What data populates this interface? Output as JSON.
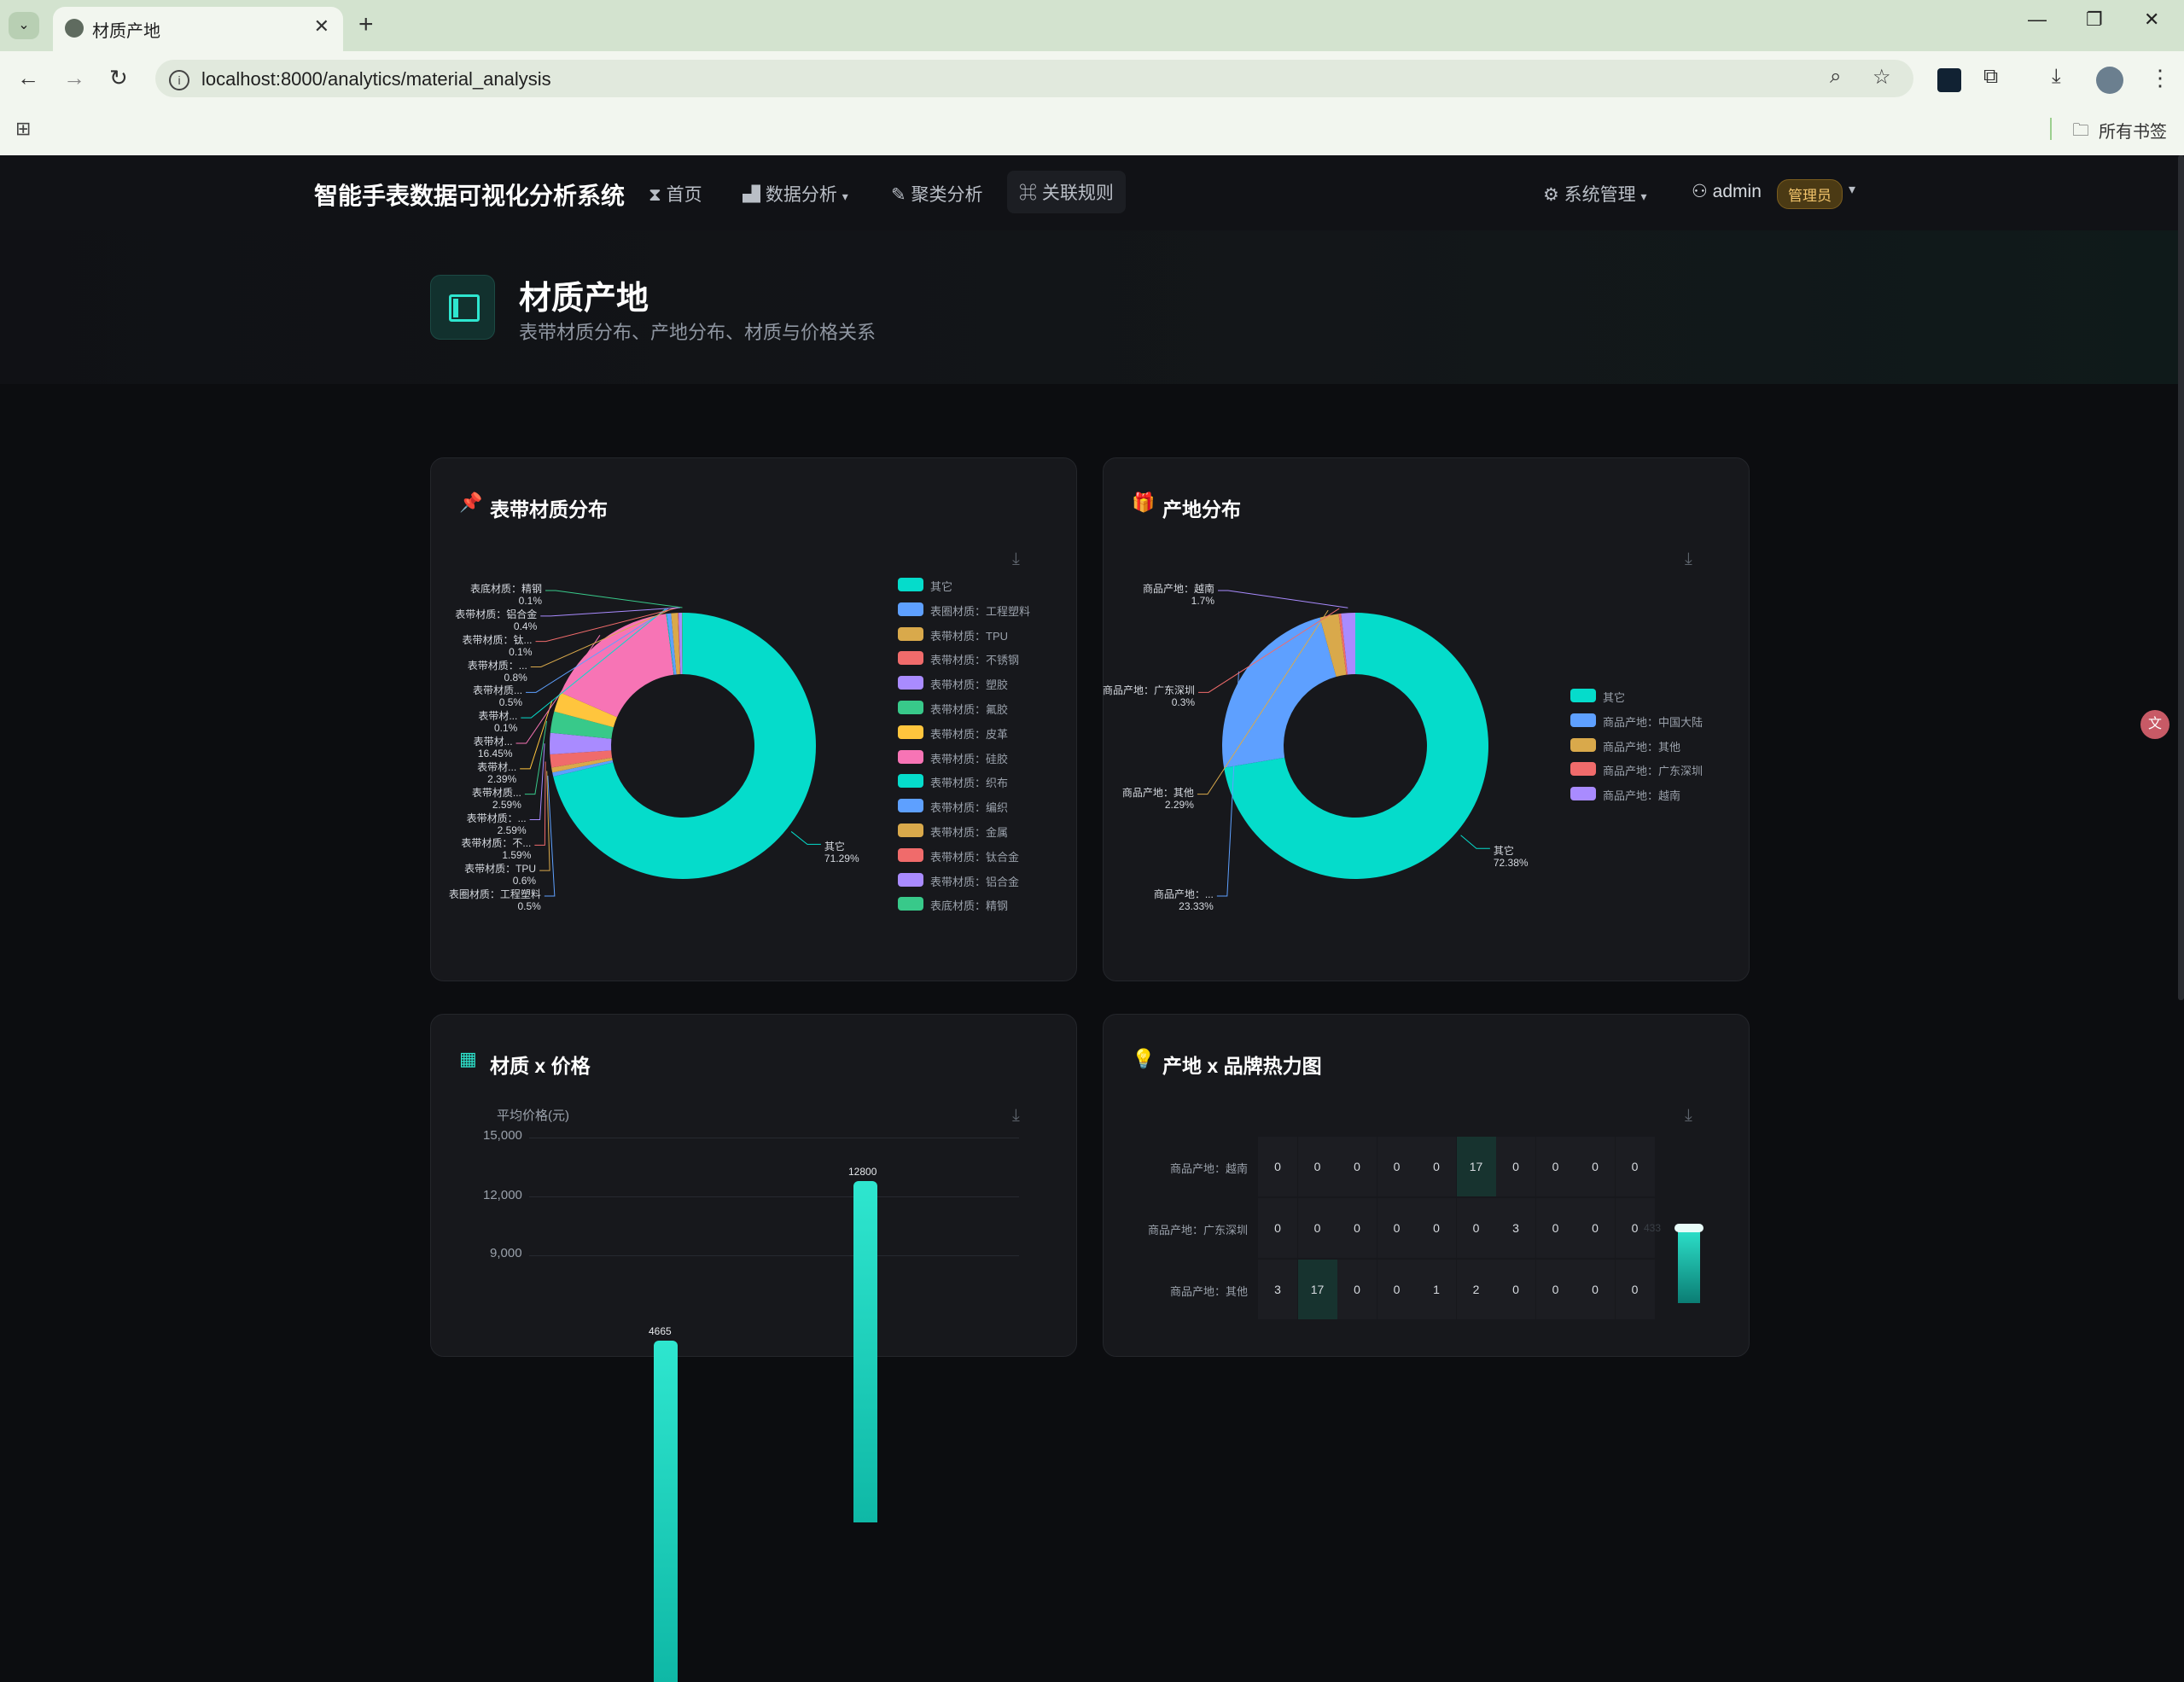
{
  "browser": {
    "tab_title": "材质产地",
    "url": "localhost:8000/analytics/material_analysis",
    "bookmarks_label": "所有书签"
  },
  "app": {
    "brand": "智能手表数据可视化分析系统",
    "nav": [
      {
        "label": "首页",
        "icon": "hourglass-icon"
      },
      {
        "label": "数据分析",
        "icon": "bar-chart-icon",
        "dropdown": true
      },
      {
        "label": "聚类分析",
        "icon": "thumbs-down-icon"
      },
      {
        "label": "关联规则",
        "icon": "gamepad-icon",
        "active": true
      }
    ],
    "system_menu": "系统管理",
    "user": "admin",
    "role_badge": "管理员"
  },
  "page": {
    "title": "材质产地",
    "subtitle": "表带材质分布、产地分布、材质与价格关系"
  },
  "cards": {
    "material": {
      "title": "表带材质分布"
    },
    "origin": {
      "title": "产地分布"
    },
    "price": {
      "title": "材质 x 价格"
    },
    "heatmap": {
      "title": "产地 x 品牌热力图"
    }
  },
  "colors": {
    "accent": "#2ee6cf",
    "palette": [
      "#05dccb",
      "#5ea0ff",
      "#d9a94b",
      "#f06b6b",
      "#a98bff",
      "#38c98a",
      "#ffc53d",
      "#f774b5",
      "#05dccb",
      "#5ea0ff",
      "#d9a94b",
      "#f06b6b",
      "#a98bff",
      "#38c98a"
    ]
  },
  "chart_data": [
    {
      "type": "pie",
      "title": "表带材质分布",
      "legend_position": "right",
      "slices": [
        {
          "label": "其它",
          "value": 71.29
        },
        {
          "label": "表圈材质：工程塑料",
          "value": 0.5
        },
        {
          "label": "表带材质：TPU",
          "value": 0.6
        },
        {
          "label": "表带材质：不锈钢",
          "value": 1.59
        },
        {
          "label": "表带材质：塑胶",
          "value": 2.59
        },
        {
          "label": "表带材质：氟胶",
          "value": 2.59
        },
        {
          "label": "表带材质：皮革",
          "value": 2.39
        },
        {
          "label": "表带材质：硅胶",
          "value": 16.45
        },
        {
          "label": "表带材质：织布",
          "value": 0.1
        },
        {
          "label": "表带材质：编织",
          "value": 0.5
        },
        {
          "label": "表带材质：金属",
          "value": 0.8
        },
        {
          "label": "表带材质：钛合金",
          "value": 0.1
        },
        {
          "label": "表带材质：铝合金",
          "value": 0.4
        },
        {
          "label": "表底材质：精钢",
          "value": 0.1
        }
      ],
      "slice_labels": [
        {
          "name": "其它",
          "pct": "71.29%"
        },
        {
          "name": "表圈材质：工程塑料",
          "pct": "0.5%"
        },
        {
          "name": "表带材质：TPU",
          "pct": "0.6%"
        },
        {
          "name": "表带材质：不...",
          "pct": "1.59%"
        },
        {
          "name": "表带材质：...",
          "pct": "2.59%"
        },
        {
          "name": "表带材质...",
          "pct": "2.59%"
        },
        {
          "name": "表带材...",
          "pct": "2.39%"
        },
        {
          "name": "表带材...",
          "pct": "16.45%"
        },
        {
          "name": "表带材...",
          "pct": "0.1%"
        },
        {
          "name": "表带材质...",
          "pct": "0.5%"
        },
        {
          "name": "表带材质：...",
          "pct": "0.8%"
        },
        {
          "name": "表带材质：钛...",
          "pct": "0.1%"
        },
        {
          "name": "表带材质：铝合金",
          "pct": "0.4%"
        },
        {
          "name": "表底材质：精钢",
          "pct": "0.1%"
        }
      ]
    },
    {
      "type": "pie",
      "title": "产地分布",
      "legend_position": "right",
      "slices": [
        {
          "label": "其它",
          "value": 72.38
        },
        {
          "label": "商品产地：中国大陆",
          "value": 23.33
        },
        {
          "label": "商品产地：其他",
          "value": 2.29
        },
        {
          "label": "商品产地：广东深圳",
          "value": 0.3
        },
        {
          "label": "商品产地：越南",
          "value": 1.7
        }
      ],
      "slice_labels": [
        {
          "name": "其它",
          "pct": "72.38%"
        },
        {
          "name": "商品产地：...",
          "pct": "23.33%"
        },
        {
          "name": "商品产地：其他",
          "pct": "2.29%"
        },
        {
          "name": "商品产地：广东深圳",
          "pct": "0.3%"
        },
        {
          "name": "商品产地：越南",
          "pct": "1.7%"
        }
      ]
    },
    {
      "type": "bar",
      "title": "材质 x 价格",
      "ylabel": "平均价格(元)",
      "y_ticks": [
        "15,000",
        "12,000",
        "9,000"
      ],
      "ylim": [
        0,
        15000
      ],
      "bars": [
        {
          "value": 4665,
          "label": "4665"
        },
        {
          "value": 12800,
          "label": "12800"
        }
      ]
    },
    {
      "type": "heatmap",
      "title": "产地 x 品牌热力图",
      "rows": [
        {
          "label": "商品产地：越南",
          "values": [
            0,
            0,
            0,
            0,
            0,
            17,
            0,
            0,
            0,
            0
          ]
        },
        {
          "label": "商品产地：广东深圳",
          "values": [
            0,
            0,
            0,
            0,
            0,
            0,
            3,
            0,
            0,
            0
          ]
        },
        {
          "label": "商品产地：其他",
          "values": [
            3,
            17,
            0,
            0,
            1,
            2,
            0,
            0,
            0,
            0
          ]
        }
      ],
      "visual_map_max": "433"
    }
  ]
}
